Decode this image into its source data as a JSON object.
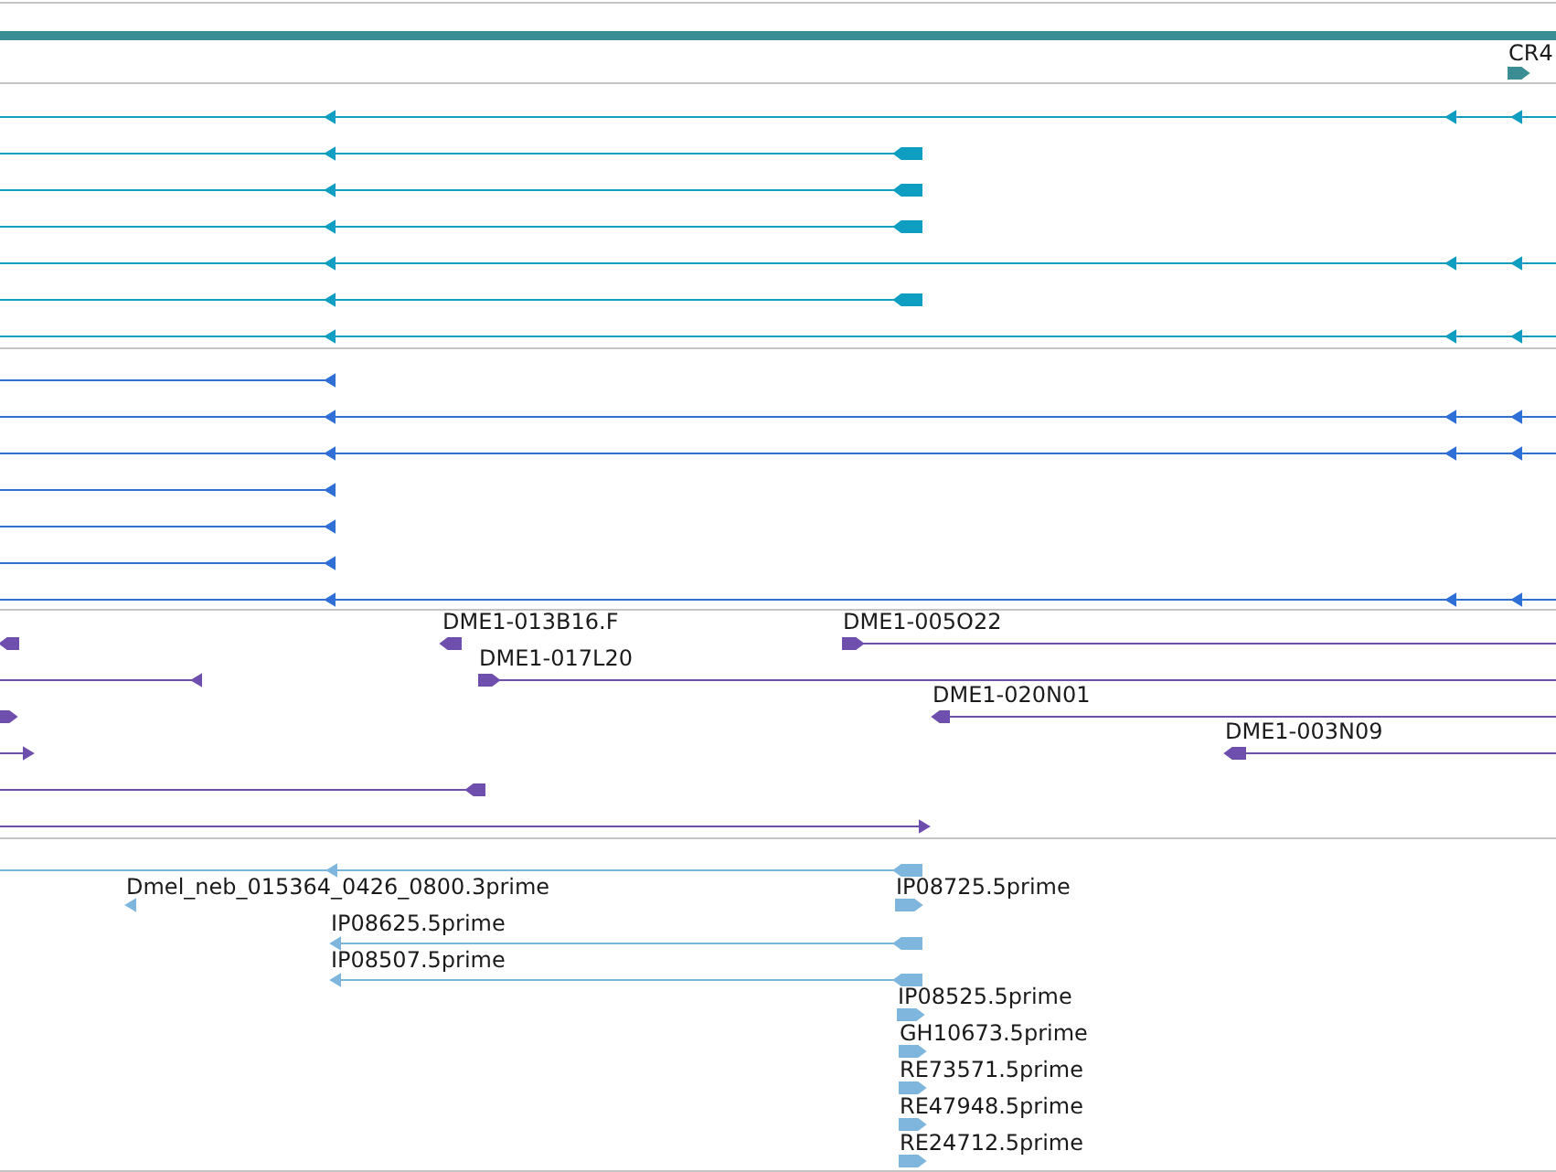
{
  "tracks": [
    {
      "features": [
        {
          "label": "CR4"
        }
      ]
    },
    {
      "features": [
        {
          "label": "DME1-013B16.F"
        },
        {
          "label": "DME1-005O22"
        },
        {
          "label": "DME1-017L20"
        },
        {
          "label": "DME1-020N01"
        },
        {
          "label": "DME1-003N09"
        }
      ]
    },
    {
      "features": [
        {
          "label": "Dmel_neb_015364_0426_0800.3prime"
        },
        {
          "label": "IP08725.5prime"
        },
        {
          "label": "IP08625.5prime"
        },
        {
          "label": "IP08507.5prime"
        },
        {
          "label": "IP08525.5prime"
        },
        {
          "label": "GH10673.5prime"
        },
        {
          "label": "RE73571.5prime"
        },
        {
          "label": "RE47948.5prime"
        },
        {
          "label": "RE24712.5prime"
        }
      ]
    }
  ]
}
